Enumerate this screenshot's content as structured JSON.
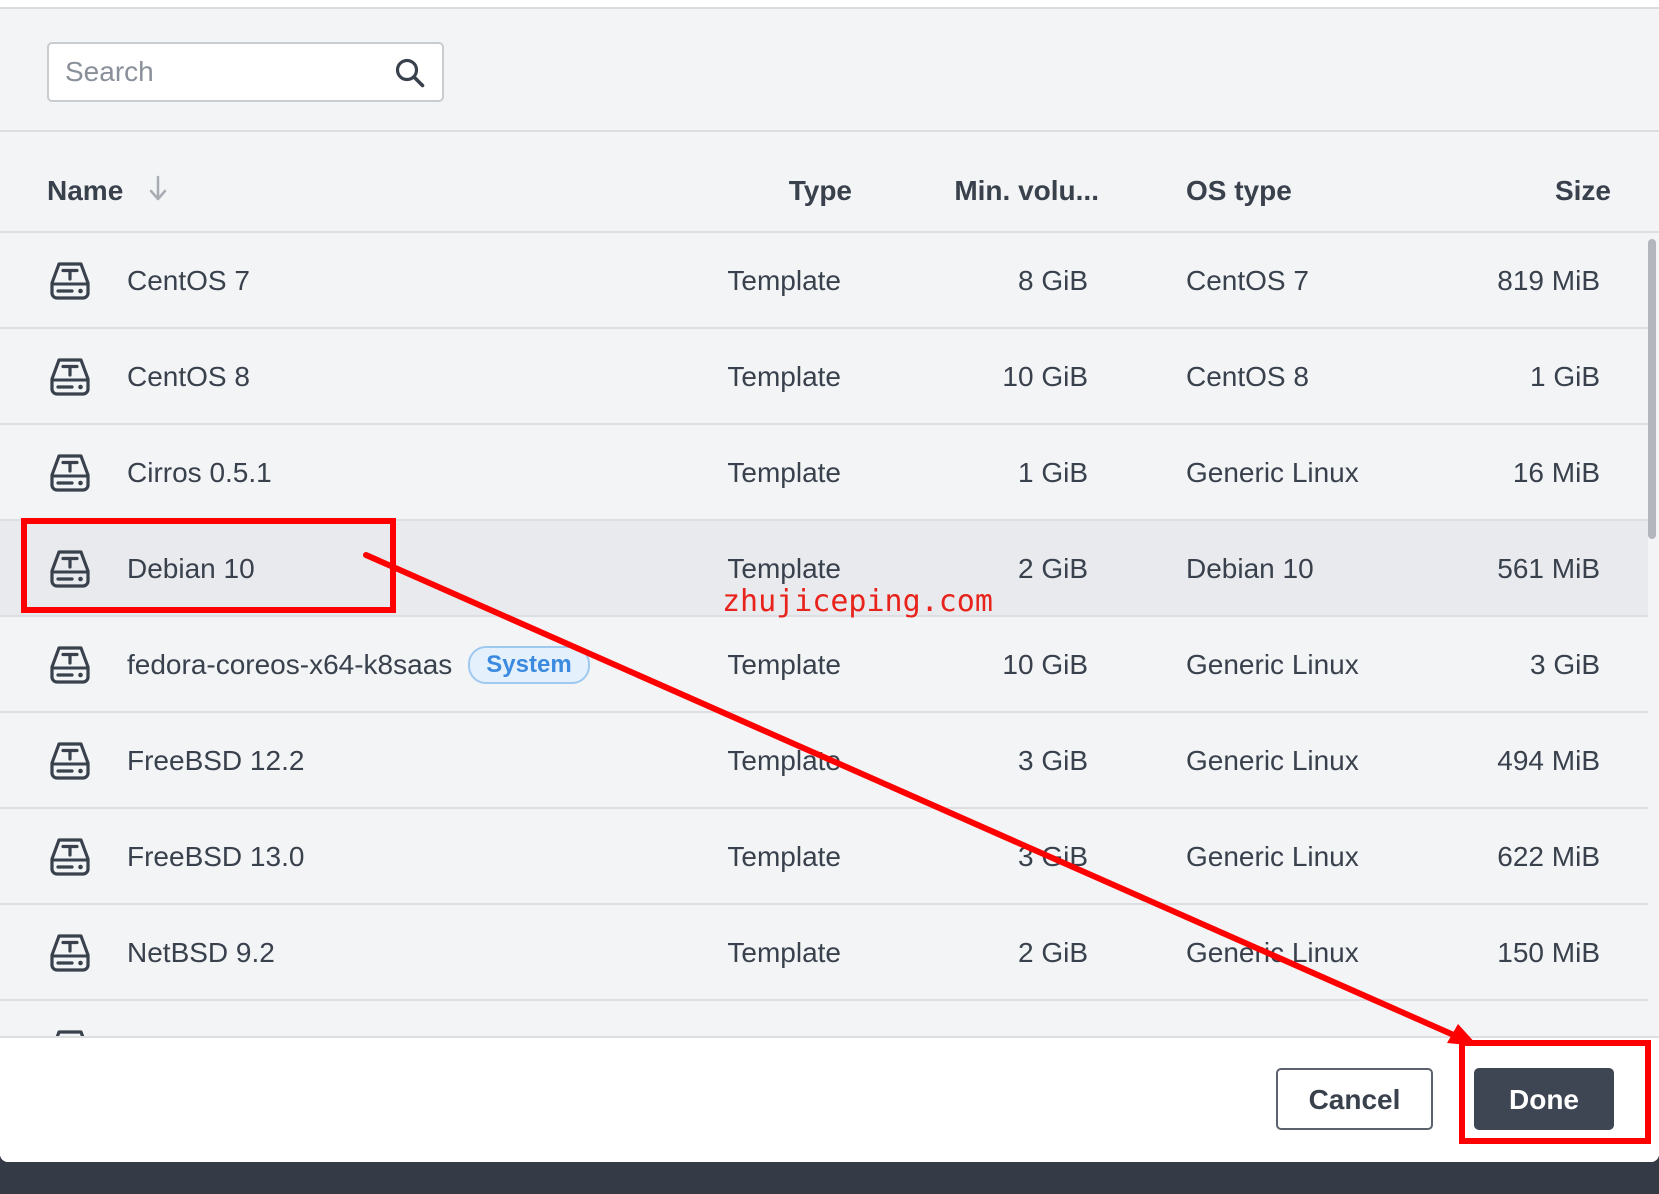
{
  "search": {
    "placeholder": "Search",
    "value": ""
  },
  "table": {
    "headers": {
      "name": "Name",
      "type": "Type",
      "min_volume": "Min. volu...",
      "os_type": "OS type",
      "size": "Size"
    },
    "sort": {
      "column": "name",
      "direction": "descending",
      "icon": "arrow-down-icon"
    },
    "rows": [
      {
        "name": "CentOS 7",
        "type": "Template",
        "min_volume": "8 GiB",
        "os_type": "CentOS 7",
        "size": "819 MiB"
      },
      {
        "name": "CentOS 8",
        "type": "Template",
        "min_volume": "10 GiB",
        "os_type": "CentOS 8",
        "size": "1 GiB"
      },
      {
        "name": "Cirros 0.5.1",
        "type": "Template",
        "min_volume": "1 GiB",
        "os_type": "Generic Linux",
        "size": "16 MiB"
      },
      {
        "name": "Debian 10",
        "type": "Template",
        "min_volume": "2 GiB",
        "os_type": "Debian 10",
        "size": "561 MiB",
        "selected": true
      },
      {
        "name": "fedora-coreos-x64-k8saas",
        "badge": "System",
        "type": "Template",
        "min_volume": "10 GiB",
        "os_type": "Generic Linux",
        "size": "3 GiB"
      },
      {
        "name": "FreeBSD 12.2",
        "type": "Template",
        "min_volume": "3 GiB",
        "os_type": "Generic Linux",
        "size": "494 MiB"
      },
      {
        "name": "FreeBSD 13.0",
        "type": "Template",
        "min_volume": "3 GiB",
        "os_type": "Generic Linux",
        "size": "622 MiB"
      },
      {
        "name": "NetBSD 9.2",
        "type": "Template",
        "min_volume": "2 GiB",
        "os_type": "Generic Linux",
        "size": "150 MiB"
      }
    ]
  },
  "footer": {
    "cancel_label": "Cancel",
    "done_label": "Done"
  },
  "annotation": {
    "watermark": "zhujiceping.com",
    "color": "#ff0000"
  },
  "colors": {
    "primary_button": "#3e4653",
    "badge_text": "#3b8ae0",
    "badge_bg": "#e4f1fd",
    "backdrop": "#343b46"
  }
}
